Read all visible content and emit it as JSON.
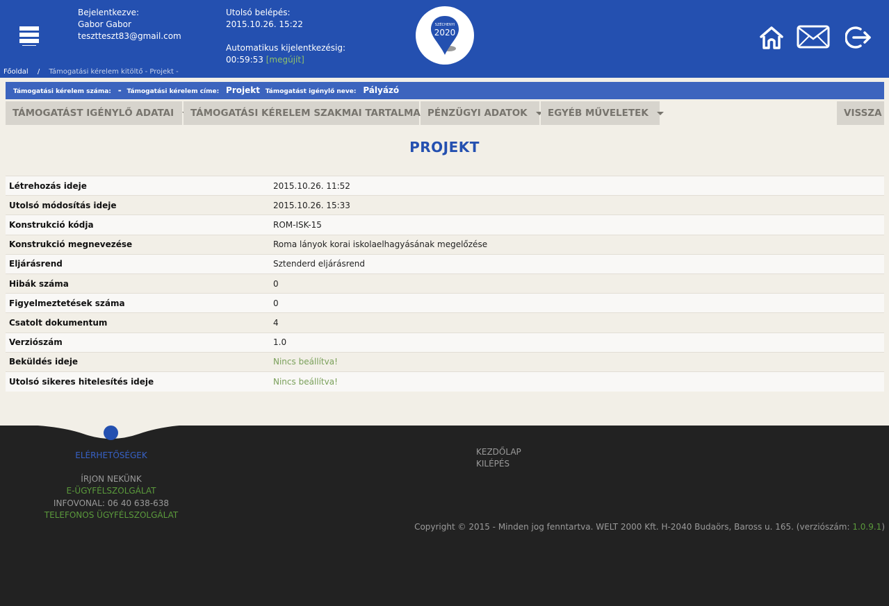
{
  "header": {
    "logged_in_label": "Bejelentkezve:",
    "user_name": "Gabor Gabor",
    "user_email": "tesztteszt83@gmail.com",
    "last_login_label": "Utolsó belépés:",
    "last_login_value": "2015.10.26. 15:22",
    "auto_logout_label": "Automatikus kijelentkezésig:",
    "auto_logout_time": "00:59:53",
    "renew_label": "[megújít]",
    "logo_top_text": "SZÉCHENYI",
    "logo_year": "2020",
    "icons": [
      "menu-icon",
      "home-icon",
      "mail-icon",
      "logout-icon"
    ]
  },
  "breadcrumb": {
    "home": "Főoldal",
    "separator": "/",
    "current": "Támogatási kérelem kitöltő - Projekt -"
  },
  "infobar": {
    "number_label": "Támogatási kérelem száma:",
    "number_value": "-",
    "title_label": "Támogatási kérelem címe:",
    "title_value": "Projekt",
    "applicant_label": "Támogatást igénylő neve:",
    "applicant_value": "Pályázó"
  },
  "menu": {
    "items": [
      {
        "label": "Támogatást igénylő adatai"
      },
      {
        "label": "Támogatási kérelem szakmai tartalma"
      },
      {
        "label": "Pénzügyi adatok"
      },
      {
        "label": "Egyéb műveletek"
      }
    ],
    "back_label": "Vissza"
  },
  "page": {
    "title": "PROJEKT"
  },
  "details": [
    {
      "key": "Létrehozás ideje",
      "value": "2015.10.26. 11:52"
    },
    {
      "key": "Utolsó módosítás ideje",
      "value": "2015.10.26. 15:33"
    },
    {
      "key": "Konstrukció kódja",
      "value": "ROM-ISK-15"
    },
    {
      "key": "Konstrukció megnevezése",
      "value": "Roma lányok korai iskolaelhagyásának megelőzése"
    },
    {
      "key": "Eljárásrend",
      "value": "Sztenderd eljárásrend"
    },
    {
      "key": "Hibák száma",
      "value": "0"
    },
    {
      "key": "Figyelmeztetések száma",
      "value": "0"
    },
    {
      "key": "Csatolt dokumentum",
      "value": "4"
    },
    {
      "key": "Verziószám",
      "value": "1.0"
    },
    {
      "key": "Beküldés ideje",
      "value": "Nincs beállítva!"
    },
    {
      "key": "Utolsó sikeres hitelesítés ideje",
      "value": "Nincs beállítva!"
    }
  ],
  "footer": {
    "contacts_title": "ELÉRHETŐSÉGEK",
    "write_us": "ÍRJON NEKÜNK",
    "e_service": "E-ÜGYFÉLSZOLGÁLAT",
    "infoline": "INFOVONAL: 06 40 638-638",
    "phone_service": "TELEFONOS ÜGYFÉLSZOLGÁLAT",
    "home_link": "KEZDŐLAP",
    "logout_link": "KILÉPÉS",
    "copyright": "Copyright © 2015 - Minden jog fenntartva. WELT 2000 Kft. H-2040 Budaörs, Baross u. 165. (verziószám: ",
    "version": "1.0.9.1",
    "copyright_end": ")"
  },
  "colors": {
    "brand_blue": "#2450b0",
    "footer_bg": "#222222",
    "accent_green": "#5b9a3c"
  }
}
